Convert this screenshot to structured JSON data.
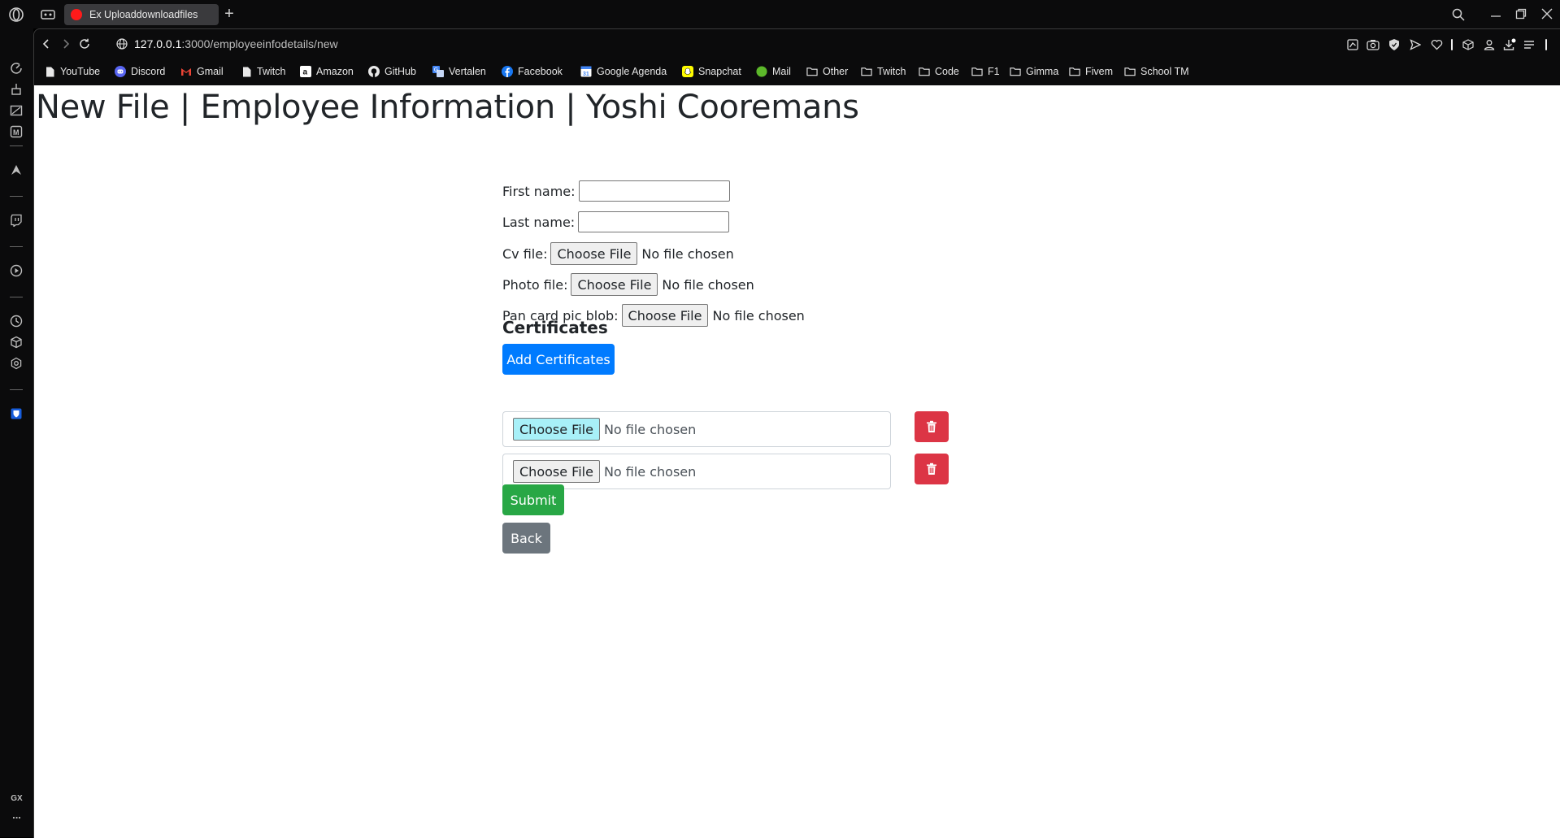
{
  "browser": {
    "tab_title": "Ex Uploaddownloadfiles",
    "url_host": "127.0.0.1",
    "url_path": ":3000/employeeinfodetails/new",
    "bookmarks": [
      {
        "label": "YouTube",
        "icon": "page-icon"
      },
      {
        "label": "Discord",
        "icon": "discord-icon"
      },
      {
        "label": "Gmail",
        "icon": "gmail-icon"
      },
      {
        "label": "Twitch",
        "icon": "page-icon"
      },
      {
        "label": "Amazon",
        "icon": "amazon-icon"
      },
      {
        "label": "GitHub",
        "icon": "github-icon"
      },
      {
        "label": "Vertalen",
        "icon": "translate-icon"
      },
      {
        "label": "Facebook",
        "icon": "facebook-icon"
      },
      {
        "label": "Google Agenda",
        "icon": "calendar-icon"
      },
      {
        "label": "Snapchat",
        "icon": "snapchat-icon"
      },
      {
        "label": "Mail",
        "icon": "mail-icon"
      },
      {
        "label": "Other",
        "icon": "folder-icon"
      },
      {
        "label": "Twitch",
        "icon": "folder-icon"
      },
      {
        "label": "Code",
        "icon": "folder-icon"
      },
      {
        "label": "F1",
        "icon": "folder-icon"
      },
      {
        "label": "Gimma",
        "icon": "folder-icon"
      },
      {
        "label": "Fivem",
        "icon": "folder-icon"
      },
      {
        "label": "School TM",
        "icon": "folder-icon"
      }
    ],
    "sidebar_label_gx": "GX",
    "sidebar_more": "...",
    "colors": {
      "chrome": "#0b0b0c",
      "tab_active": "#3a3a3d",
      "tab_favicon": "#ff1a1a"
    }
  },
  "page": {
    "title": "New File | Employee Information | Yoshi Cooremans",
    "fields": {
      "first_name_label": "First name:",
      "last_name_label": "Last name:",
      "cv_label": "Cv file:",
      "photo_label": "Photo file:",
      "pan_label": "Pan card pic blob:",
      "choose_file": "Choose File",
      "no_file": "No file chosen"
    },
    "certificates": {
      "heading": "Certificates",
      "add_label": "Add Certificates",
      "items": [
        {
          "choose": "Choose File",
          "status": "No file chosen"
        },
        {
          "choose": "Choose File",
          "status": "No file chosen"
        }
      ]
    },
    "submit_label": "Submit",
    "back_label": "Back",
    "colors": {
      "primary": "#007bff",
      "danger": "#dc3545",
      "success": "#28a745",
      "secondary": "#6c757d"
    }
  }
}
